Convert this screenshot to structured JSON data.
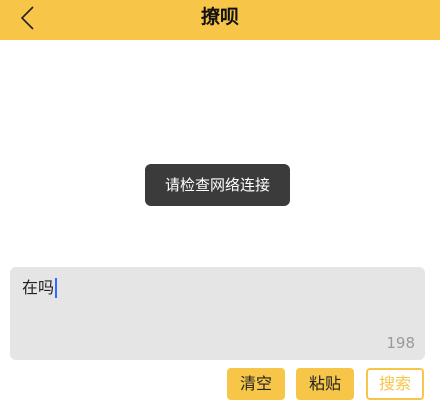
{
  "header": {
    "title": "撩呗",
    "back_icon": "chevron-left-icon",
    "background_color": "#f7c648"
  },
  "toast": {
    "message": "请检查网络连接"
  },
  "input": {
    "value": "在吗",
    "char_count": "198"
  },
  "actions": {
    "clear_label": "清空",
    "paste_label": "粘贴",
    "search_label": "搜索"
  }
}
